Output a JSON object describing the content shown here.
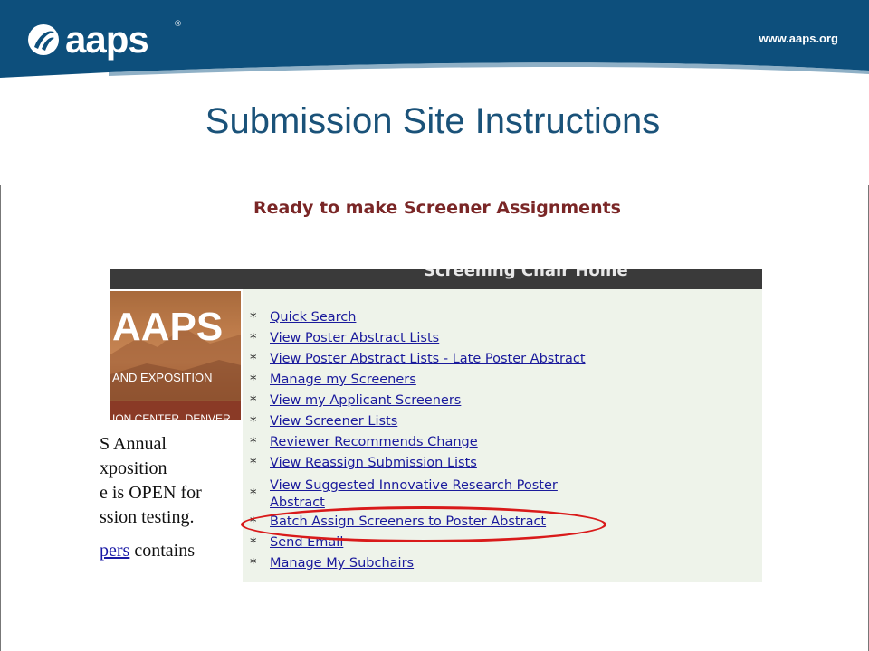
{
  "header": {
    "logo_text": "aaps",
    "registered_mark": "®",
    "site_url": "www.aaps.org"
  },
  "slide": {
    "title": "Submission Site Instructions",
    "subtitle": "Ready to make Screener Assignments"
  },
  "screenshot": {
    "page_title": "Screening Chair Home",
    "conference_banner": {
      "logo_text": "AAPS",
      "line1": "AND EXPOSITION",
      "line2": "ION CENTER, DENVER"
    },
    "intro_lines": [
      "S Annual",
      "xposition",
      "e is OPEN for",
      "ssion testing."
    ],
    "intro_link": "pers",
    "intro_tail": " contains",
    "bullet": "*",
    "menu": [
      {
        "label": "Quick Search"
      },
      {
        "label": "View Poster Abstract Lists"
      },
      {
        "label": "View Poster Abstract Lists - Late Poster Abstract"
      },
      {
        "label": "Manage my Screeners"
      },
      {
        "label": "View my Applicant Screeners"
      },
      {
        "label": "View Screener Lists"
      },
      {
        "label": "Reviewer Recommends Change"
      },
      {
        "label": "View Reassign Submission Lists"
      },
      {
        "label": "View Suggested Innovative Research Poster Abstract"
      },
      {
        "label": "Batch Assign Screeners to Poster Abstract",
        "highlighted": true
      },
      {
        "label": "Send Email"
      },
      {
        "label": "Manage My Subchairs"
      }
    ]
  },
  "colors": {
    "banner_blue": "#0d4f7c",
    "title_blue": "#1a5279",
    "subtitle_red": "#7a2626",
    "highlight_red": "#d91a1a",
    "link_blue": "#1a1a9c",
    "panel_bg": "#eef3ea",
    "shot_header": "#3a3a3a"
  }
}
